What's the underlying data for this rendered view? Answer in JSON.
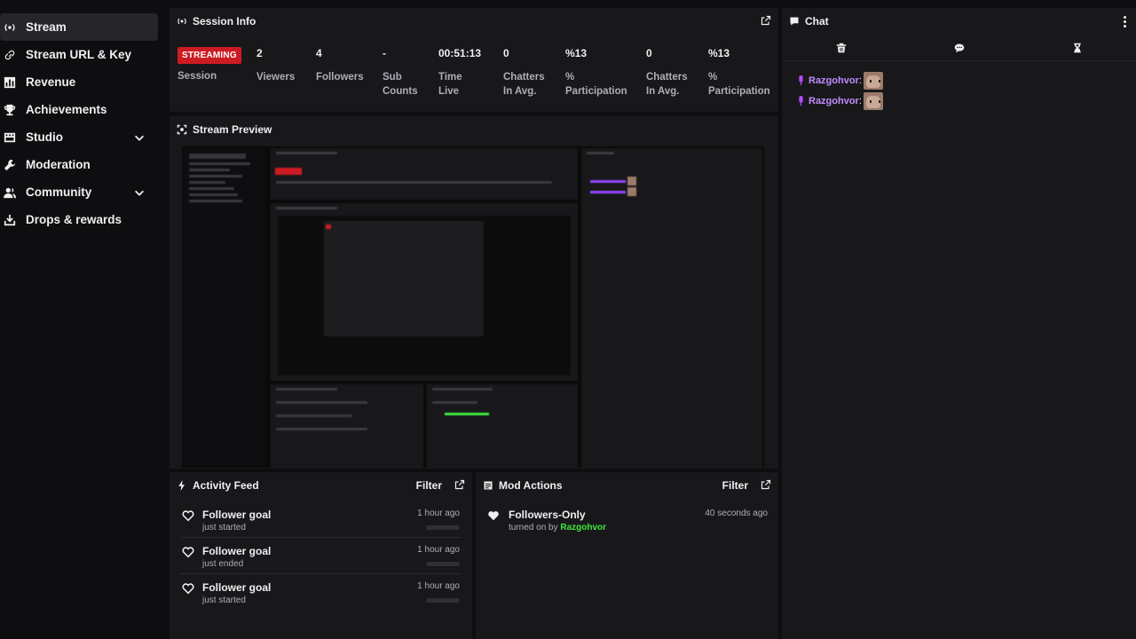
{
  "sidebar": {
    "items": [
      {
        "label": "Stream",
        "icon": "stream-icon",
        "active": true,
        "expandable": false
      },
      {
        "label": "Stream URL & Key",
        "icon": "link-icon",
        "active": false,
        "expandable": false
      },
      {
        "label": "Revenue",
        "icon": "chart-icon",
        "active": false,
        "expandable": false
      },
      {
        "label": "Achievements",
        "icon": "trophy-icon",
        "active": false,
        "expandable": false
      },
      {
        "label": "Studio",
        "icon": "film-icon",
        "active": false,
        "expandable": true
      },
      {
        "label": "Moderation",
        "icon": "wrench-icon",
        "active": false,
        "expandable": false
      },
      {
        "label": "Community",
        "icon": "users-icon",
        "active": false,
        "expandable": true
      },
      {
        "label": "Drops & rewards",
        "icon": "gift-icon",
        "active": false,
        "expandable": false
      }
    ]
  },
  "session": {
    "title": "Session Info",
    "status_badge": "STREAMING",
    "status_label": "Session",
    "stats": [
      {
        "value": "2",
        "label": "Viewers"
      },
      {
        "value": "4",
        "label": "Followers"
      },
      {
        "value": "-",
        "label": "Sub Counts"
      },
      {
        "value": "00:51:13",
        "label": "Time Live"
      },
      {
        "value": "0",
        "label": "Chatters In Avg."
      },
      {
        "value": "%13",
        "label": "% Participation"
      },
      {
        "value": "0",
        "label": "Chatters In Avg."
      },
      {
        "value": "%13",
        "label": "% Participation"
      }
    ]
  },
  "preview": {
    "title": "Stream Preview"
  },
  "activity": {
    "title": "Activity Feed",
    "filter_label": "Filter",
    "items": [
      {
        "title": "Follower goal",
        "sub": "just started",
        "time": "1 hour ago"
      },
      {
        "title": "Follower goal",
        "sub": "just ended",
        "time": "1 hour ago"
      },
      {
        "title": "Follower goal",
        "sub": "just started",
        "time": "1 hour ago"
      }
    ]
  },
  "mod": {
    "title": "Mod Actions",
    "filter_label": "Filter",
    "items": [
      {
        "title": "Followers-Only",
        "sub_prefix": "turned on by",
        "user": "Razgohvor",
        "time": "40 seconds ago"
      }
    ]
  },
  "chat": {
    "title": "Chat",
    "messages": [
      {
        "user": "Razgohvor",
        "colon": ":"
      },
      {
        "user": "Razgohvor",
        "colon": ":"
      }
    ]
  },
  "colors": {
    "accent": "#b549ff",
    "live": "#cc1b23",
    "mod_user": "#3ee63e"
  }
}
